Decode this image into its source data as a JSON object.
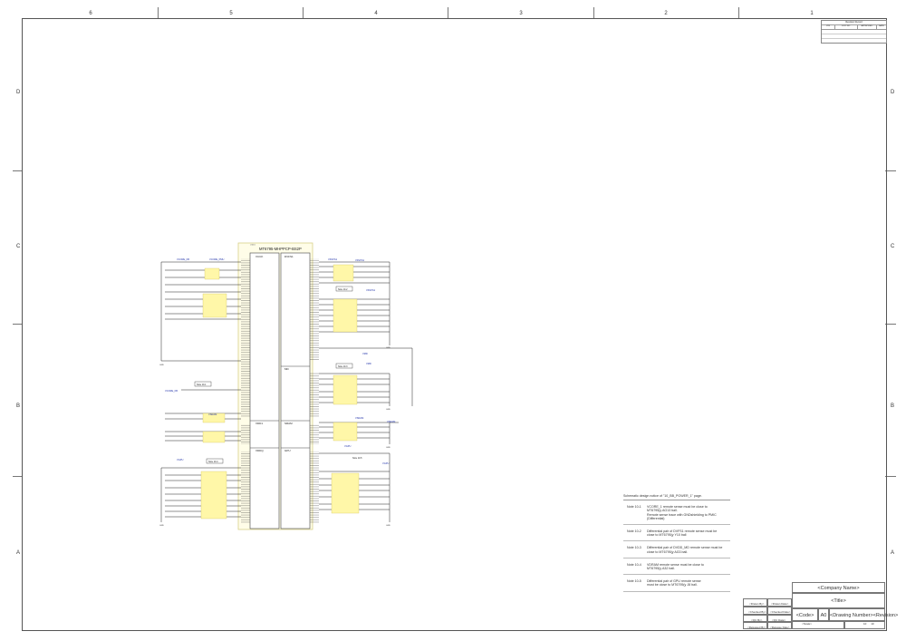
{
  "border": {
    "columns": [
      "6",
      "5",
      "4",
      "3",
      "2",
      "1"
    ],
    "rows": [
      "D",
      "C",
      "B",
      "A"
    ]
  },
  "revision_table": {
    "title": "Revision Record",
    "headers": [
      "LTR",
      "ECO NO:",
      "APPROVED:",
      "DATE:"
    ]
  },
  "schematic": {
    "part_ref": "U1001",
    "part_name": "MT6795-MHPPCP-BS2P",
    "blocks": [
      "VCCK",
      "DVFS1",
      "MD",
      "VDD1",
      "SRAM",
      "VDDQ",
      "GPU"
    ],
    "net_labels": {
      "vccore_fb": "VCORE_FB",
      "vccore_p": "VCORE_PMU",
      "vsram": "VSRAM",
      "vdvfs1": "VDVFS1",
      "vmd": "VMD",
      "vgpu": "VGPU",
      "gnd": "GND"
    },
    "note_refs": [
      "Note 10-1",
      "Note 10-2",
      "Note 10-3",
      "Note 10-4",
      "Note 10-5"
    ]
  },
  "notes": {
    "header": "Schematic design notice of \"10_BB_POWER_1\" page.",
    "items": [
      {
        "id": "Note 10-1",
        "text": "VCORE_1 remote sense must be close to\nMT6795(y AG13 ball.\nRemote sense trace with GNDshielding to PMIC\n(Differential)"
      },
      {
        "id": "Note 10-2",
        "text": "Differential pair of DVFS1 remote sense must be\nclose to MT6795(y Y10 ball"
      },
      {
        "id": "Note 10-3",
        "text": "Differential pair of DVDD_MD remote sense must be\nclose to MT6795(y AG3 ball."
      },
      {
        "id": "Note 10-4",
        "text": "VDRAM remote sense must be close to\nMT6795(y A32 ball."
      },
      {
        "id": "Note 10-5",
        "text": "Differential pair of GPU remote sense\nmust be close to MT6795(y J8 ball."
      }
    ]
  },
  "title_block": {
    "company": "<Company Name>",
    "title": "<Title>",
    "code": "<Code>",
    "size": "A0",
    "drawing_number": "<Drawing Number>",
    "revision": "<Revision>",
    "drawn_by": "<Drawn By>",
    "drawn_date": "<Drawn Date>",
    "checked_by": "<Checked By>",
    "checked_date": "<Checked Date>",
    "qc_by": "<QC By>",
    "qc_date": "<QC Date>",
    "released_by": "<Released By>",
    "released_date": "<Release Date>",
    "scale": "<Scale>",
    "sheet": "10",
    "of": "10"
  }
}
